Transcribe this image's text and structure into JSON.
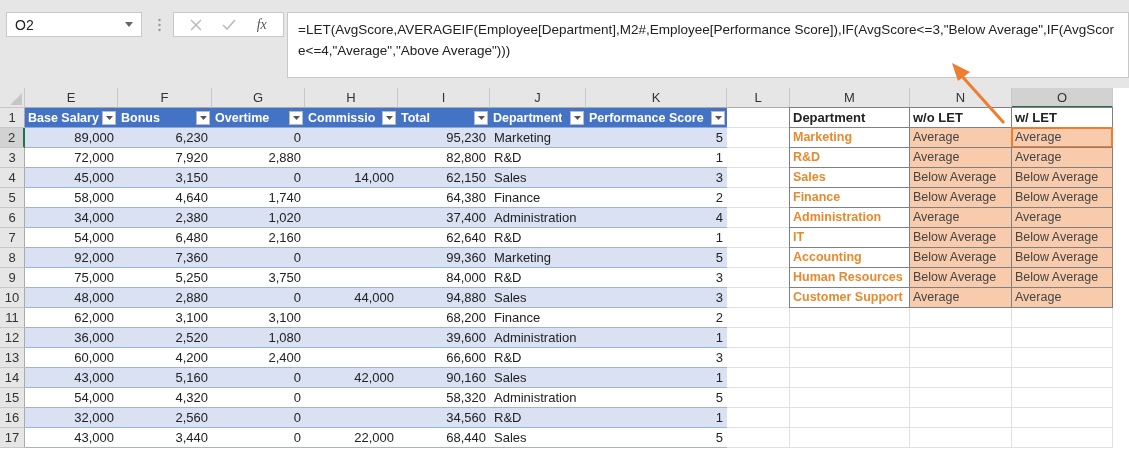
{
  "name_box": {
    "value": "O2"
  },
  "formula_bar": {
    "function_label": "fx",
    "formula": "=LET(AvgScore,AVERAGEIF(Employee[Department],M2#,Employee[Performance Score]),IF(AvgScore<=3,\"Below Average\",IF(AvgScore<=4,\"Average\",\"Above Average\")))"
  },
  "sheet": {
    "columns": [
      {
        "label": "E",
        "selected": false
      },
      {
        "label": "F",
        "selected": false
      },
      {
        "label": "G",
        "selected": false
      },
      {
        "label": "H",
        "selected": false
      },
      {
        "label": "I",
        "selected": false
      },
      {
        "label": "J",
        "selected": false
      },
      {
        "label": "K",
        "selected": false
      },
      {
        "label": "L",
        "selected": false
      },
      {
        "label": "M",
        "selected": false
      },
      {
        "label": "N",
        "selected": false
      },
      {
        "label": "O",
        "selected": true
      }
    ],
    "row_numbers": [
      {
        "label": "1",
        "selected": false
      },
      {
        "label": "2",
        "selected": true
      },
      {
        "label": "3",
        "selected": false
      },
      {
        "label": "4",
        "selected": false
      },
      {
        "label": "5",
        "selected": false
      },
      {
        "label": "6",
        "selected": false
      },
      {
        "label": "7",
        "selected": false
      },
      {
        "label": "8",
        "selected": false
      },
      {
        "label": "9",
        "selected": false
      },
      {
        "label": "10",
        "selected": false
      },
      {
        "label": "11",
        "selected": false
      },
      {
        "label": "12",
        "selected": false
      },
      {
        "label": "13",
        "selected": false
      },
      {
        "label": "14",
        "selected": false
      },
      {
        "label": "15",
        "selected": false
      },
      {
        "label": "16",
        "selected": false
      },
      {
        "label": "17",
        "selected": false
      }
    ]
  },
  "employee_table": {
    "columns": [
      {
        "label": "Base Salary",
        "kind": "number"
      },
      {
        "label": "Bonus",
        "kind": "number"
      },
      {
        "label": "Overtime",
        "kind": "number"
      },
      {
        "label": "Commissio",
        "kind": "number"
      },
      {
        "label": "Total",
        "kind": "number"
      },
      {
        "label": "Department",
        "kind": "text"
      },
      {
        "label": "Performance Score",
        "kind": "number"
      }
    ],
    "rows": [
      [
        "89,000",
        "6,230",
        "0",
        null,
        "95,230",
        "Marketing",
        "5"
      ],
      [
        "72,000",
        "7,920",
        "2,880",
        null,
        "82,800",
        "R&D",
        "1"
      ],
      [
        "45,000",
        "3,150",
        "0",
        "14,000",
        "62,150",
        "Sales",
        "3"
      ],
      [
        "58,000",
        "4,640",
        "1,740",
        null,
        "64,380",
        "Finance",
        "2"
      ],
      [
        "34,000",
        "2,380",
        "1,020",
        null,
        "37,400",
        "Administration",
        "4"
      ],
      [
        "54,000",
        "6,480",
        "2,160",
        null,
        "62,640",
        "R&D",
        "1"
      ],
      [
        "92,000",
        "7,360",
        "0",
        null,
        "99,360",
        "Marketing",
        "5"
      ],
      [
        "75,000",
        "5,250",
        "3,750",
        null,
        "84,000",
        "R&D",
        "3"
      ],
      [
        "48,000",
        "2,880",
        "0",
        "44,000",
        "94,880",
        "Sales",
        "3"
      ],
      [
        "62,000",
        "3,100",
        "3,100",
        null,
        "68,200",
        "Finance",
        "2"
      ],
      [
        "36,000",
        "2,520",
        "1,080",
        null,
        "39,600",
        "Administration",
        "1"
      ],
      [
        "60,000",
        "4,200",
        "2,400",
        null,
        "66,600",
        "R&D",
        "3"
      ],
      [
        "43,000",
        "5,160",
        "0",
        "42,000",
        "90,160",
        "Sales",
        "1"
      ],
      [
        "54,000",
        "4,320",
        "0",
        null,
        "58,320",
        "Administration",
        "5"
      ],
      [
        "32,000",
        "2,560",
        "0",
        null,
        "34,560",
        "R&D",
        "1"
      ],
      [
        "43,000",
        "3,440",
        "0",
        "22,000",
        "68,440",
        "Sales",
        "5"
      ]
    ]
  },
  "summary_table": {
    "columns": [
      "Department",
      "w/o LET",
      "w/ LET"
    ],
    "rows": [
      {
        "cells": [
          "Marketing",
          "Average",
          "Average"
        ],
        "selected": true
      },
      {
        "cells": [
          "R&D",
          "Average",
          "Average"
        ],
        "selected": false
      },
      {
        "cells": [
          "Sales",
          "Below Average",
          "Below Average"
        ],
        "selected": false
      },
      {
        "cells": [
          "Finance",
          "Below Average",
          "Below Average"
        ],
        "selected": false
      },
      {
        "cells": [
          "Administration",
          "Average",
          "Average"
        ],
        "selected": false
      },
      {
        "cells": [
          "IT",
          "Below Average",
          "Below Average"
        ],
        "selected": false
      },
      {
        "cells": [
          "Accounting",
          "Below Average",
          "Below Average"
        ],
        "selected": false
      },
      {
        "cells": [
          "Human Resources",
          "Below Average",
          "Below Average"
        ],
        "selected": false
      },
      {
        "cells": [
          "Customer Support",
          "Average",
          "Average"
        ],
        "selected": false
      }
    ]
  }
}
